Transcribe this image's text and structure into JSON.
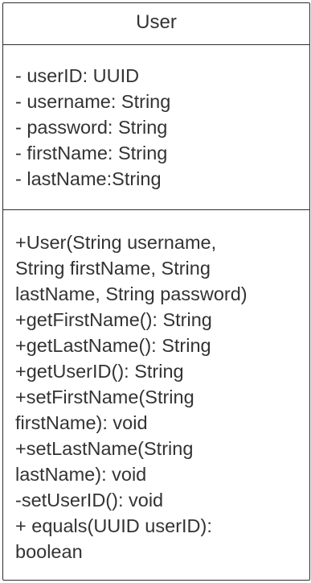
{
  "uml_class": {
    "name": "User",
    "attributes": [
      "- userID: UUID",
      "- username: String",
      "- password: String",
      "- firstName: String",
      "- lastName:String"
    ],
    "method_lines": [
      "+User(String username,",
      "String firstName, String",
      "lastName, String password)",
      "+getFirstName(): String",
      "+getLastName(): String",
      "+getUserID(): String",
      "+setFirstName(String",
      "firstName): void",
      "+setLastName(String",
      "lastName): void",
      "-setUserID(): void",
      "+ equals(UUID userID):",
      "boolean"
    ]
  }
}
